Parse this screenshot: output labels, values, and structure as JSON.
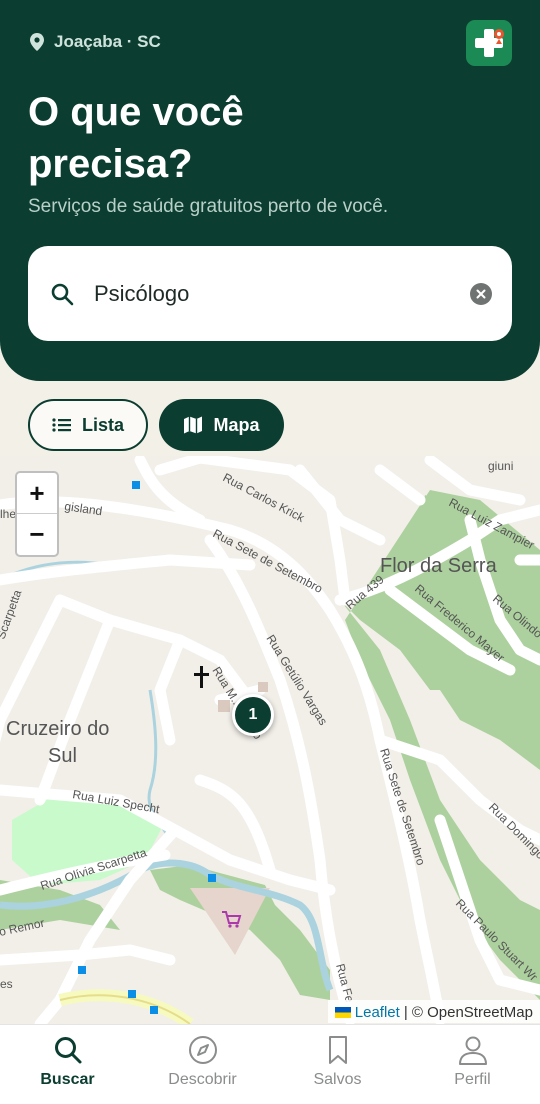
{
  "header": {
    "location": "Joaçaba · SC",
    "title": "O que você precisa?",
    "subtitle": "Serviços de saúde gratuitos perto de você."
  },
  "search": {
    "value": "Psicólogo"
  },
  "view_toggle": {
    "list_label": "Lista",
    "map_label": "Mapa",
    "selected": "Mapa"
  },
  "map": {
    "zoom_in": "+",
    "zoom_out": "−",
    "cluster_count": "1",
    "attribution_link": "Leaflet",
    "attribution_text": "| © OpenStreetMap",
    "labels": {
      "flor": "Flor da Serra",
      "cruzeiro1": "Cruzeiro do",
      "cruzeiro2": "Sul",
      "carlos": "Rua Carlos Krick",
      "sete": "Rua Sete de Setembro",
      "sete2": "Rua Sete de Setembro",
      "r439": "Rua 439",
      "frederico": "Rua Frederico Mayer",
      "getulio": "Rua Getúlio Vargas",
      "lutero": "Rua M... Lutero",
      "zampieri": "Rua Luiz Zampier",
      "olindo": "Rua Olindo",
      "specht": "Rua Luiz Specht",
      "olivia": "Rua Olívia Scarpetta",
      "domingos": "Rua Domingos",
      "paulo": "Rua Paulo Stuart Wr",
      "gisland": "gisland",
      "scarpetta": "Scarpetta",
      "remor": "o Remor",
      "giuni": "giuni",
      "rua_fe": "Rua Fe",
      "es": "es",
      "lhe": "lhe"
    }
  },
  "nav": {
    "items": [
      {
        "label": "Buscar",
        "icon": "search-icon",
        "active": true
      },
      {
        "label": "Descobrir",
        "icon": "compass-icon",
        "active": false
      },
      {
        "label": "Salvos",
        "icon": "bookmark-icon",
        "active": false
      },
      {
        "label": "Perfil",
        "icon": "user-icon",
        "active": false
      }
    ]
  },
  "colors": {
    "primary": "#0b3d30",
    "accent": "#1c8a55",
    "background": "#f3f0e8"
  }
}
